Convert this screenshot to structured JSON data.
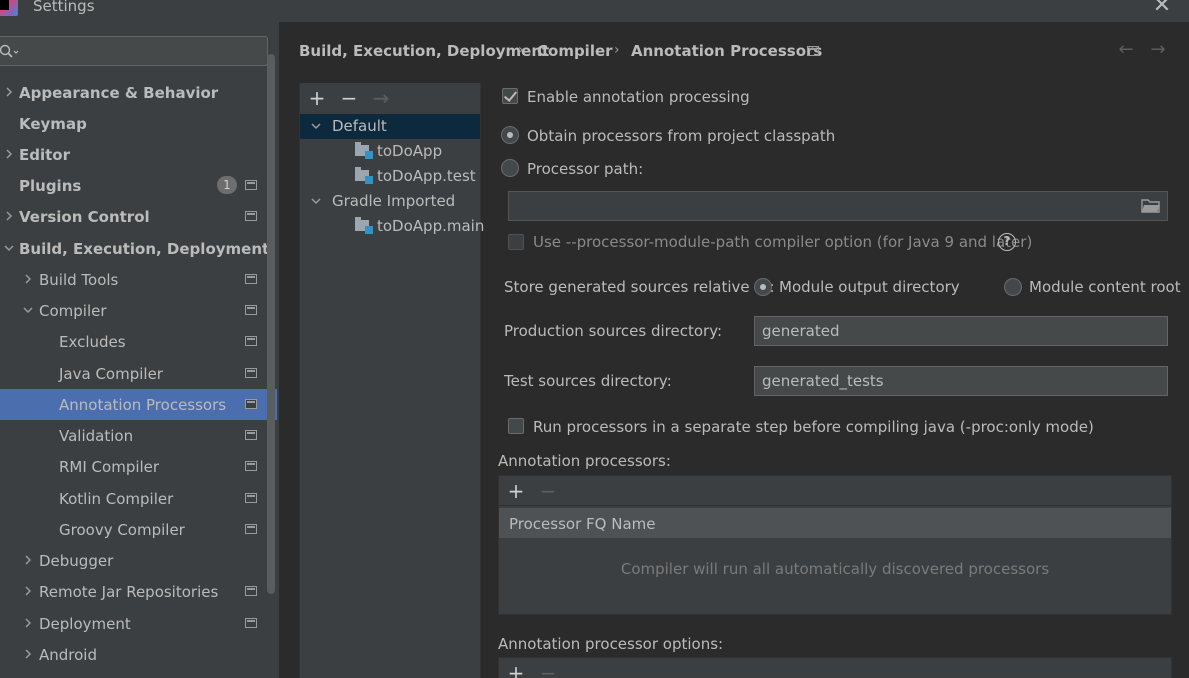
{
  "window": {
    "title": "Settings",
    "close_glyph": "✕"
  },
  "search": {
    "placeholder": "",
    "value": ""
  },
  "sidebar": {
    "items": [
      {
        "label": "Appearance & Behavior",
        "bold": true,
        "expand": "collapsed",
        "level": 0
      },
      {
        "label": "Keymap",
        "bold": true,
        "expand": "none",
        "level": 0
      },
      {
        "label": "Editor",
        "bold": true,
        "expand": "collapsed",
        "level": 0
      },
      {
        "label": "Plugins",
        "bold": true,
        "expand": "none",
        "level": 0,
        "badge": "1",
        "project_icon": true
      },
      {
        "label": "Version Control",
        "bold": true,
        "expand": "collapsed",
        "level": 0,
        "project_icon": true
      },
      {
        "label": "Build, Execution, Deployment",
        "bold": true,
        "expand": "expanded",
        "level": 0
      },
      {
        "label": "Build Tools",
        "bold": false,
        "expand": "collapsed",
        "level": 1,
        "project_icon": true
      },
      {
        "label": "Compiler",
        "bold": false,
        "expand": "expanded",
        "level": 1,
        "project_icon": true
      },
      {
        "label": "Excludes",
        "bold": false,
        "expand": "none",
        "level": 2,
        "project_icon": true
      },
      {
        "label": "Java Compiler",
        "bold": false,
        "expand": "none",
        "level": 2,
        "project_icon": true
      },
      {
        "label": "Annotation Processors",
        "bold": false,
        "expand": "none",
        "level": 2,
        "project_icon": true,
        "selected": true
      },
      {
        "label": "Validation",
        "bold": false,
        "expand": "none",
        "level": 2,
        "project_icon": true
      },
      {
        "label": "RMI Compiler",
        "bold": false,
        "expand": "none",
        "level": 2,
        "project_icon": true
      },
      {
        "label": "Kotlin Compiler",
        "bold": false,
        "expand": "none",
        "level": 2,
        "project_icon": true
      },
      {
        "label": "Groovy Compiler",
        "bold": false,
        "expand": "none",
        "level": 2,
        "project_icon": true
      },
      {
        "label": "Debugger",
        "bold": false,
        "expand": "collapsed",
        "level": 1
      },
      {
        "label": "Remote Jar Repositories",
        "bold": false,
        "expand": "collapsed",
        "level": 1,
        "project_icon": true
      },
      {
        "label": "Deployment",
        "bold": false,
        "expand": "collapsed",
        "level": 1,
        "project_icon": true
      },
      {
        "label": "Android",
        "bold": false,
        "expand": "collapsed",
        "level": 1
      }
    ]
  },
  "breadcrumb": {
    "items": [
      "Build, Execution, Deployment",
      "Compiler",
      "Annotation Processors"
    ],
    "separator": "›"
  },
  "nav": {
    "back": "←",
    "forward": "→"
  },
  "profiles": {
    "toolbar": {
      "add": "+",
      "remove": "−",
      "move": "→"
    },
    "tree": [
      {
        "label": "Default",
        "kind": "profile",
        "expanded": true,
        "selected": true
      },
      {
        "label": "toDoApp",
        "kind": "module"
      },
      {
        "label": "toDoApp.test",
        "kind": "module"
      },
      {
        "label": "Gradle Imported",
        "kind": "profile",
        "expanded": true
      },
      {
        "label": "toDoApp.main",
        "kind": "module"
      }
    ]
  },
  "form": {
    "enable_annotation": {
      "label": "Enable annotation processing",
      "checked": true
    },
    "obtain_classpath": {
      "label": "Obtain processors from project classpath",
      "checked": true
    },
    "processor_path": {
      "label": "Processor path:",
      "checked": false,
      "value": ""
    },
    "module_path": {
      "label": "Use --processor-module-path compiler option (for Java 9 and later)",
      "checked": false,
      "help": "?"
    },
    "store_relative": {
      "label": "Store generated sources relative to:"
    },
    "module_output": {
      "label": "Module output directory",
      "checked": true
    },
    "module_content": {
      "label": "Module content root",
      "checked": false
    },
    "production_dir": {
      "label": "Production sources directory:",
      "value": "generated"
    },
    "test_dir": {
      "label": "Test sources directory:",
      "value": "generated_tests"
    },
    "separate_step": {
      "label": "Run processors in a separate step before compiling java (-proc:only mode)",
      "checked": false
    }
  },
  "processors_table": {
    "title": "Annotation processors:",
    "add": "+",
    "remove": "−",
    "column": "Processor FQ Name",
    "empty_text": "Compiler will run all automatically discovered processors",
    "options_title": "Annotation processor options:"
  }
}
